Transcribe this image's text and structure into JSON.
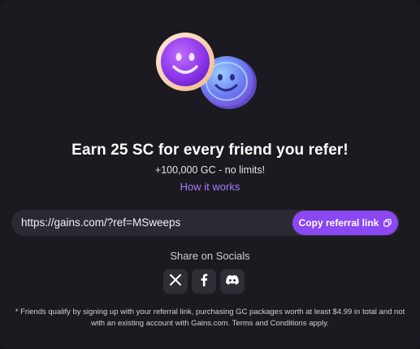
{
  "referral": {
    "headline": "Earn 25 SC for every friend you refer!",
    "subline": "+100,000 GC - no limits!",
    "how_it_works": "How it works",
    "link": "https://gains.com/?ref=MSweeps",
    "copy_label": "Copy referral link",
    "copy_icon": "copy-icon"
  },
  "share": {
    "label": "Share on Socials",
    "items": [
      {
        "name": "x-icon"
      },
      {
        "name": "facebook-icon"
      },
      {
        "name": "discord-icon"
      }
    ]
  },
  "footnote": "* Friends qualify by signing up with your referral link, purchasing GC packages worth at least $4.99 in total and not with an existing account with Gains.com. Terms and Conditions apply.",
  "colors": {
    "accent": "#8a47f2",
    "link": "#a778ff",
    "background": "#1b1a20",
    "input_bg": "#2b2a32"
  }
}
